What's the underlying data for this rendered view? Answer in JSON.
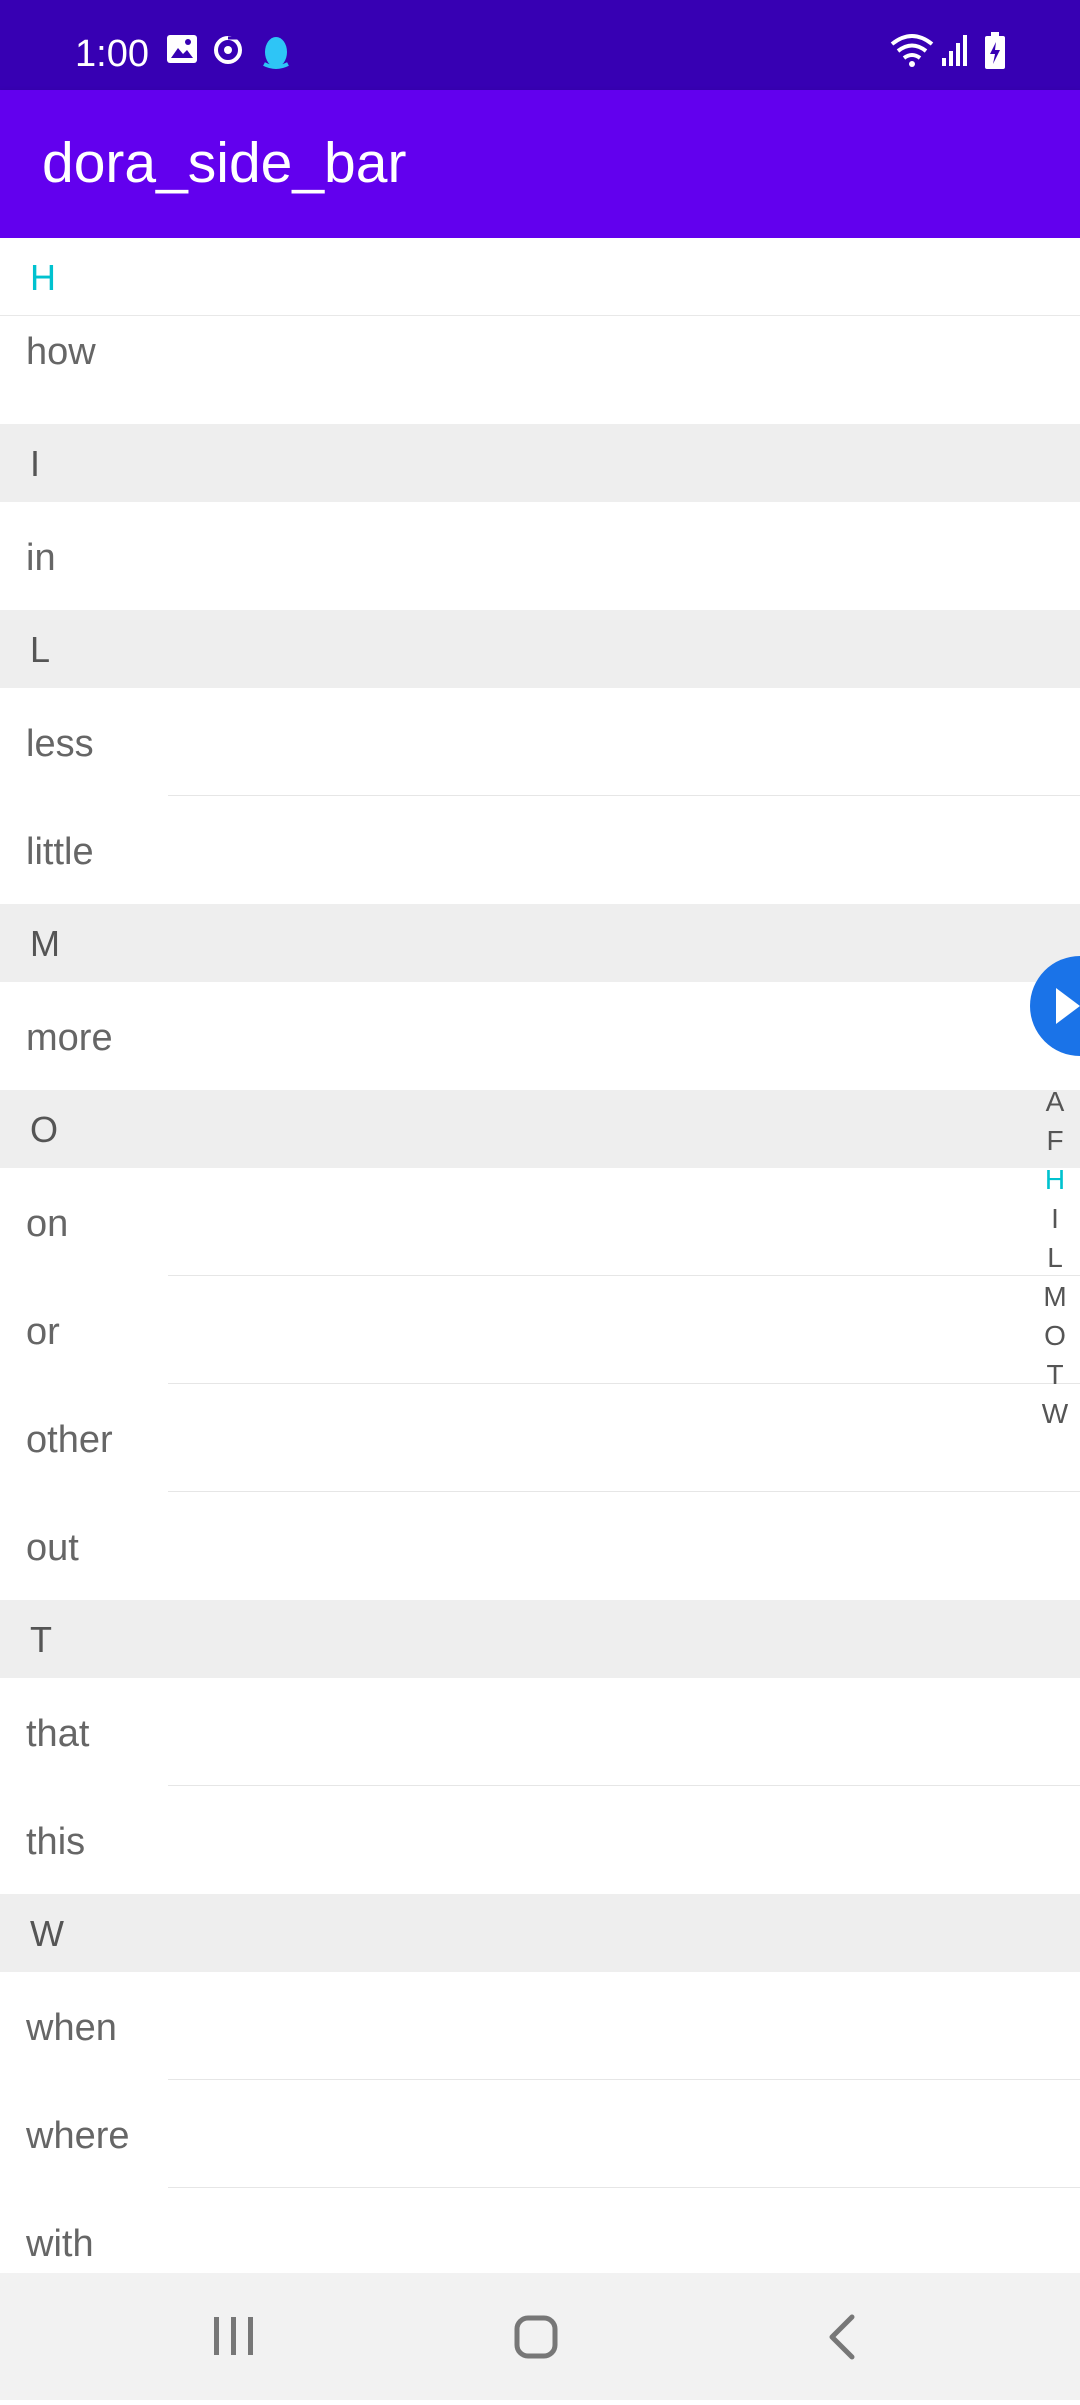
{
  "status_bar": {
    "time": "1:00",
    "left_icons": [
      "image-icon",
      "sync-icon",
      "qq-penguin-icon"
    ],
    "right_icons": [
      "wifi-icon",
      "signal-icon",
      "battery-charging-icon"
    ]
  },
  "app_bar": {
    "title": "dora_side_bar"
  },
  "list": {
    "pinned_header": "H",
    "sections": [
      {
        "letter": "H",
        "items": [
          "how"
        ]
      },
      {
        "letter": "I",
        "items": [
          "in"
        ]
      },
      {
        "letter": "L",
        "items": [
          "less",
          "little"
        ]
      },
      {
        "letter": "M",
        "items": [
          "more"
        ]
      },
      {
        "letter": "O",
        "items": [
          "on",
          "or",
          "other",
          "out"
        ]
      },
      {
        "letter": "T",
        "items": [
          "that",
          "this"
        ]
      },
      {
        "letter": "W",
        "items": [
          "when",
          "where",
          "with"
        ]
      }
    ]
  },
  "side_index": {
    "letters": [
      "A",
      "F",
      "H",
      "I",
      "L",
      "M",
      "O",
      "T",
      "W"
    ],
    "active": "H"
  },
  "float_button": {
    "icon": "play-icon"
  },
  "nav_bar": {
    "buttons": [
      "recents-icon",
      "home-icon",
      "back-icon"
    ]
  },
  "colors": {
    "status_bar": "#3700b3",
    "app_bar": "#6200ee",
    "accent": "#00c2cf",
    "section_bg": "#eeeeee",
    "float_button": "#1a73e8"
  }
}
